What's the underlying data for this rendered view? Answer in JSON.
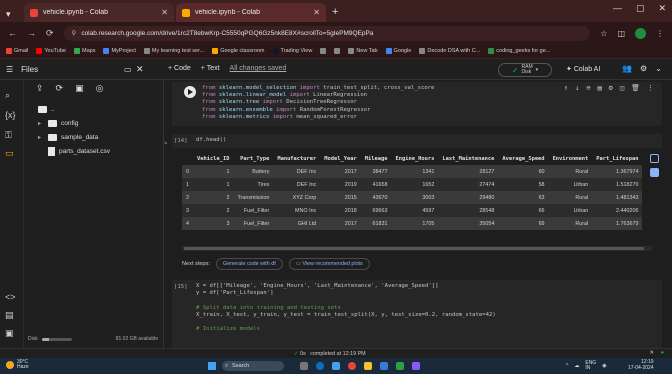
{
  "browser": {
    "tabs": [
      {
        "title": "vehicle.ipynb - Colab",
        "active": false
      },
      {
        "title": "vehicle.ipynb - Colab",
        "active": true
      }
    ],
    "url": "colab.research.google.com/drive/1rc2T8ebwKrp-C5550qPGQ6Gz5nk8E8X#scrollTo=5gIePM9QEpPa",
    "bookmarks": [
      "Gmail",
      "YouTube",
      "Maps",
      "MyProject",
      "My learning test ser...",
      "Google classroom",
      "Trading View",
      "New Tab",
      "Google",
      "Decode DSA with C...",
      "coding_geeks for ge..."
    ]
  },
  "colab": {
    "files_title": "Files",
    "toolbar": {
      "code": "+ Code",
      "text": "+ Text",
      "changes": "All changes saved"
    },
    "ram_label": "RAM",
    "disk_label": "Disk",
    "colab_ai": "Colab AI",
    "tree": {
      "parent": "..",
      "folders": [
        "config",
        "sample_data"
      ],
      "files": [
        "parts_dataset.csv"
      ]
    },
    "disk_status": "81.02 GB available",
    "disk_fraction": 0.25
  },
  "cells": {
    "import_lines": [
      {
        "kw1": "from",
        "mod": " sklearn.model_selection ",
        "kw2": "import",
        "names": " train_test_split, cross_val_score"
      },
      {
        "kw1": "from",
        "mod": " sklearn.linear_model ",
        "kw2": "import",
        "names": " LinearRegression"
      },
      {
        "kw1": "from",
        "mod": " sklearn.tree ",
        "kw2": "import",
        "names": " DecisionTreeRegressor"
      },
      {
        "kw1": "from",
        "mod": " sklearn.ensemble ",
        "kw2": "import",
        "names": " RandomForestRegressor"
      },
      {
        "kw1": "from",
        "mod": " sklearn.metrics ",
        "kw2": "import",
        "names": " mean_squared_error"
      }
    ],
    "head_label": "[14]",
    "head_code": "df.head()",
    "table": {
      "columns": [
        "",
        "Vehicle_ID",
        "Part_Type",
        "Manufacturer",
        "Model_Year",
        "Mileage",
        "Engine_Hours",
        "Last_Maintenance",
        "Average_Speed",
        "Environment",
        "Part_Lifespan"
      ],
      "rows": [
        [
          "0",
          "1",
          "Battery",
          "DEF Inc",
          "2017",
          "38477",
          "1341",
          "28127",
          "60",
          "Rural",
          "1.367974"
        ],
        [
          "1",
          "1",
          "Tires",
          "DEF Inc",
          "2019",
          "41658",
          "1652",
          "27474",
          "58",
          "Urban",
          "1.518270"
        ],
        [
          "2",
          "2",
          "Transmission",
          "XYZ Corp",
          "2015",
          "43670",
          "3003",
          "29480",
          "63",
          "Rural",
          "1.481343"
        ],
        [
          "3",
          "2",
          "Fuel_Filter",
          "MNO Inc",
          "2018",
          "69663",
          "4597",
          "28548",
          "66",
          "Urban",
          "2.440206"
        ],
        [
          "4",
          "3",
          "Fuel_Filter",
          "GHI Ltd",
          "2017",
          "61831",
          "1705",
          "35054",
          "69",
          "Rural",
          "1.763679"
        ]
      ]
    },
    "next_steps": "Next steps:",
    "gen_code": "Generate code with df",
    "view_plots": "View recommended plots",
    "train_label": "[15]",
    "train_lines": [
      "X = df[['Mileage', 'Engine_Hours', 'Last_Maintenance', 'Average_Speed']]",
      "y = df['Part_Lifespan']",
      "",
      "# Split data into training and testing sets",
      "X_train, X_test, y_train, y_test = train_test_split(X, y, test_size=0.2, random_state=42)",
      "",
      "# Initialize models"
    ]
  },
  "status": {
    "duration": "0s",
    "text": "completed at 12:19 PM"
  },
  "taskbar": {
    "weather_temp": "30°C",
    "weather_desc": "Haze",
    "search": "Search",
    "lang": "ENG",
    "region": "IN",
    "time": "12:19",
    "date": "17-04-2024"
  }
}
